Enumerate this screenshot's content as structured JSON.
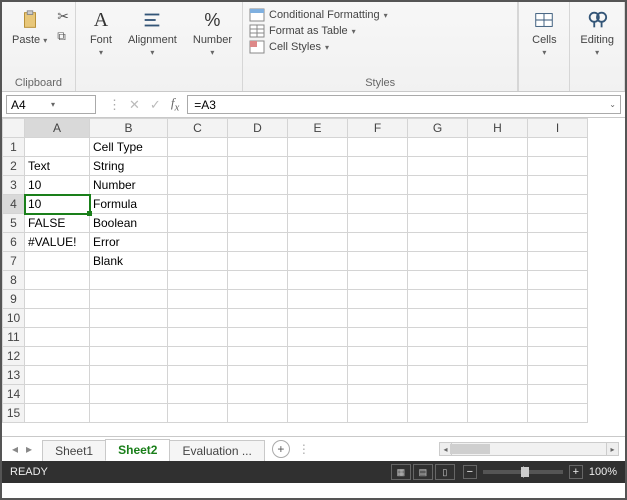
{
  "ribbon": {
    "clipboard": {
      "paste": "Paste",
      "label": "Clipboard"
    },
    "font": {
      "btn": "Font",
      "label": "Font"
    },
    "alignment": {
      "btn": "Alignment",
      "label": "Alignment"
    },
    "number": {
      "btn": "Number",
      "label": "Number"
    },
    "styles": {
      "cond": "Conditional Formatting",
      "table": "Format as Table",
      "cell": "Cell Styles",
      "label": "Styles"
    },
    "cells": {
      "btn": "Cells",
      "label": "Cells"
    },
    "editing": {
      "btn": "Editing",
      "label": "Editing"
    }
  },
  "namebox": "A4",
  "formula": "=A3",
  "columns": [
    "A",
    "B",
    "C",
    "D",
    "E",
    "F",
    "G",
    "H",
    "I"
  ],
  "rows": [
    "1",
    "2",
    "3",
    "4",
    "5",
    "6",
    "7",
    "8",
    "9",
    "10",
    "11",
    "12",
    "13",
    "14",
    "15"
  ],
  "cells": {
    "B1": "Cell Type",
    "A2": "Text",
    "B2": "String",
    "A3": "10",
    "B3": "Number",
    "A4": "10",
    "B4": "Formula",
    "A5": "FALSE",
    "B5": "Boolean",
    "A6": "#VALUE!",
    "B6": "Error",
    "B7": "Blank"
  },
  "tabs": {
    "sheet1": "Sheet1",
    "sheet2": "Sheet2",
    "eval": "Evaluation  ..."
  },
  "status": {
    "ready": "READY",
    "zoom": "100%"
  }
}
